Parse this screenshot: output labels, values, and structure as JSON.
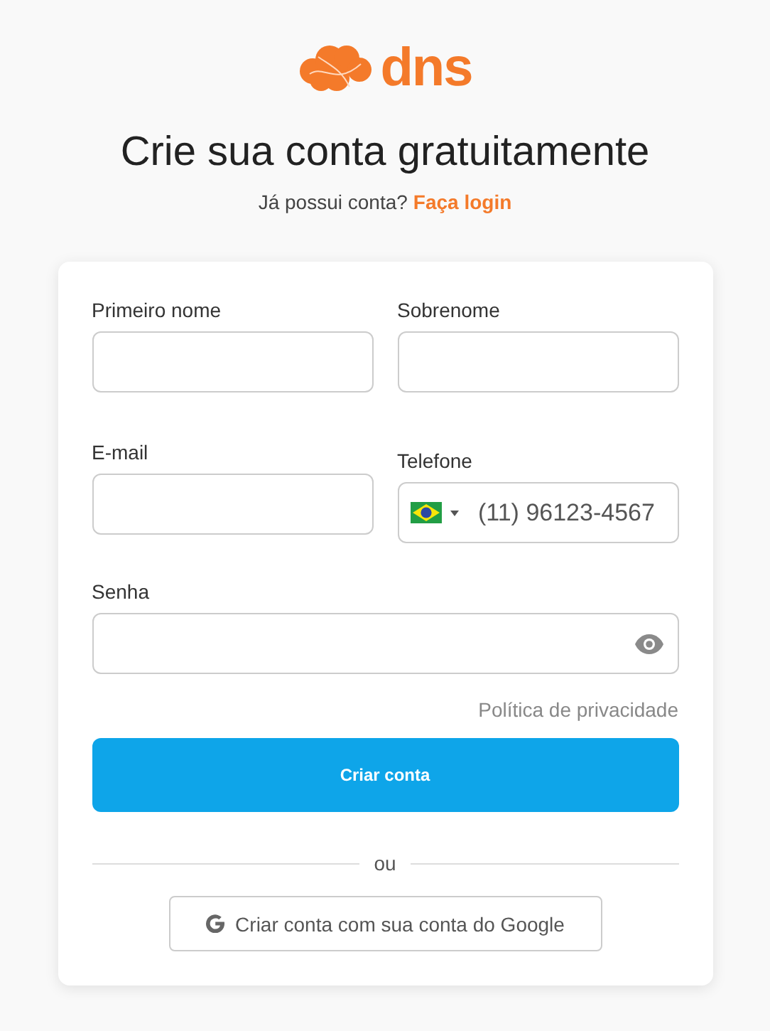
{
  "logo": {
    "text": "dns"
  },
  "title": "Crie sua conta gratuitamente",
  "login_prompt": {
    "text": "Já possui conta?",
    "link": "Faça login"
  },
  "form": {
    "rows": [
      {
        "fields": [
          {
            "label": "Primeiro nome",
            "kind": "text"
          },
          {
            "label": "Sobrenome",
            "kind": "text"
          }
        ]
      },
      {
        "fields": [
          {
            "label": "E-mail",
            "kind": "text"
          },
          {
            "label": "Telefone",
            "kind": "phone",
            "placeholder": "(11) 96123-4567"
          }
        ]
      },
      {
        "fields": [
          {
            "label": "Senha",
            "kind": "password"
          }
        ]
      }
    ],
    "privacy_link": "Política de privacidade",
    "submit": "Criar conta",
    "divider": "ou",
    "google_button": "Criar conta com sua conta do Google"
  }
}
